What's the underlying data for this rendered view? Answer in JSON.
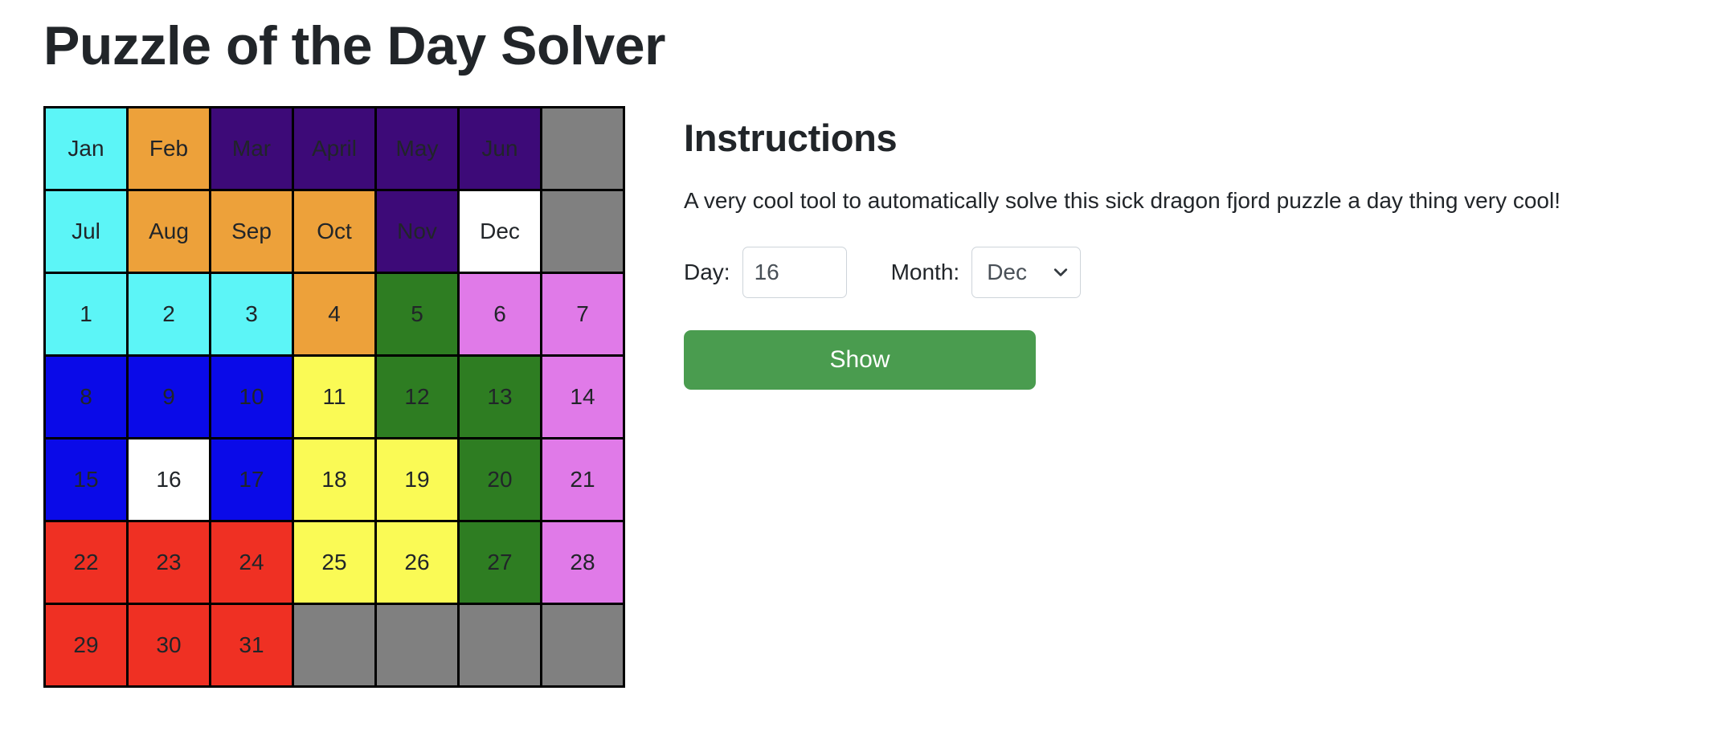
{
  "page_title": "Puzzle of the Day Solver",
  "instructions": {
    "heading": "Instructions",
    "text": "A very cool tool to automatically solve this sick dragon fjord puzzle a day thing very cool!"
  },
  "form": {
    "day_label": "Day:",
    "day_value": "16",
    "month_label": "Month:",
    "month_value": "Dec",
    "month_options": [
      "Jan",
      "Feb",
      "Mar",
      "April",
      "May",
      "Jun",
      "Jul",
      "Aug",
      "Sep",
      "Oct",
      "Nov",
      "Dec"
    ],
    "submit_label": "Show",
    "chevron_icon": "chevron-down-icon"
  },
  "colors": {
    "cyan": "#5CF5F7",
    "orange": "#EDA13A",
    "purple": "#3D0A78",
    "gray": "#808080",
    "white": "#FFFFFF",
    "green": "#2E7D22",
    "violet": "#E07AE8",
    "blue": "#0A0AE8",
    "yellow": "#FAFA55",
    "red": "#EF3023",
    "accent_green": "#4A9C4F",
    "border": "#000000"
  },
  "board": {
    "rows": [
      [
        {
          "label": "Jan",
          "color": "#5CF5F7"
        },
        {
          "label": "Feb",
          "color": "#EDA13A"
        },
        {
          "label": "Mar",
          "color": "#3D0A78"
        },
        {
          "label": "April",
          "color": "#3D0A78"
        },
        {
          "label": "May",
          "color": "#3D0A78"
        },
        {
          "label": "Jun",
          "color": "#3D0A78"
        },
        {
          "label": "",
          "color": "#808080"
        }
      ],
      [
        {
          "label": "Jul",
          "color": "#5CF5F7"
        },
        {
          "label": "Aug",
          "color": "#EDA13A"
        },
        {
          "label": "Sep",
          "color": "#EDA13A"
        },
        {
          "label": "Oct",
          "color": "#EDA13A"
        },
        {
          "label": "Nov",
          "color": "#3D0A78"
        },
        {
          "label": "Dec",
          "color": "#FFFFFF"
        },
        {
          "label": "",
          "color": "#808080"
        }
      ],
      [
        {
          "label": "1",
          "color": "#5CF5F7"
        },
        {
          "label": "2",
          "color": "#5CF5F7"
        },
        {
          "label": "3",
          "color": "#5CF5F7"
        },
        {
          "label": "4",
          "color": "#EDA13A"
        },
        {
          "label": "5",
          "color": "#2E7D22"
        },
        {
          "label": "6",
          "color": "#E07AE8"
        },
        {
          "label": "7",
          "color": "#E07AE8"
        }
      ],
      [
        {
          "label": "8",
          "color": "#0A0AE8"
        },
        {
          "label": "9",
          "color": "#0A0AE8"
        },
        {
          "label": "10",
          "color": "#0A0AE8"
        },
        {
          "label": "11",
          "color": "#FAFA55"
        },
        {
          "label": "12",
          "color": "#2E7D22"
        },
        {
          "label": "13",
          "color": "#2E7D22"
        },
        {
          "label": "14",
          "color": "#E07AE8"
        }
      ],
      [
        {
          "label": "15",
          "color": "#0A0AE8"
        },
        {
          "label": "16",
          "color": "#FFFFFF"
        },
        {
          "label": "17",
          "color": "#0A0AE8"
        },
        {
          "label": "18",
          "color": "#FAFA55"
        },
        {
          "label": "19",
          "color": "#FAFA55"
        },
        {
          "label": "20",
          "color": "#2E7D22"
        },
        {
          "label": "21",
          "color": "#E07AE8"
        }
      ],
      [
        {
          "label": "22",
          "color": "#EF3023"
        },
        {
          "label": "23",
          "color": "#EF3023"
        },
        {
          "label": "24",
          "color": "#EF3023"
        },
        {
          "label": "25",
          "color": "#FAFA55"
        },
        {
          "label": "26",
          "color": "#FAFA55"
        },
        {
          "label": "27",
          "color": "#2E7D22"
        },
        {
          "label": "28",
          "color": "#E07AE8"
        }
      ],
      [
        {
          "label": "29",
          "color": "#EF3023"
        },
        {
          "label": "30",
          "color": "#EF3023"
        },
        {
          "label": "31",
          "color": "#EF3023"
        },
        {
          "label": "",
          "color": "#808080"
        },
        {
          "label": "",
          "color": "#808080"
        },
        {
          "label": "",
          "color": "#808080"
        },
        {
          "label": "",
          "color": "#808080"
        }
      ]
    ]
  }
}
